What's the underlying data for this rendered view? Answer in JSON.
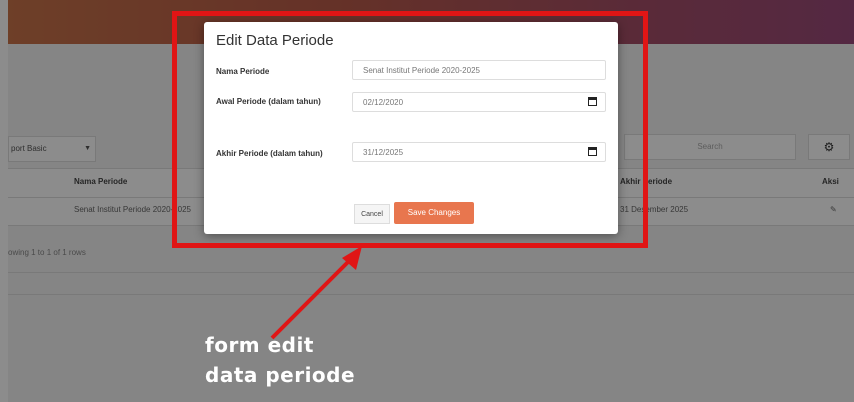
{
  "background": {
    "export_label": "port Basic",
    "search_placeholder": "Search",
    "table": {
      "headers": [
        "Nama Periode",
        "Akhir Periode",
        "Aksi"
      ],
      "row": {
        "nama_periode": "Senat Institut Periode 2020-2025",
        "akhir_periode": "31 Desember 2025"
      }
    },
    "showing": "owing 1 to 1 of 1 rows"
  },
  "modal": {
    "title": "Edit Data Periode",
    "fields": [
      {
        "label": "Nama Periode",
        "value": "Senat Institut Periode 2020-2025"
      },
      {
        "label": "Awal Periode (dalam tahun)",
        "value": "02/12/2020"
      },
      {
        "label": "Akhir Periode (dalam tahun)",
        "value": "31/12/2025"
      }
    ],
    "cancel_label": "Cancel",
    "save_label": "Save Changes"
  },
  "annotation": {
    "caption_line1": "form edit",
    "caption_line2": "data periode",
    "color": "#e01515"
  },
  "icons": {
    "gear": "gear-icon",
    "calendar": "calendar-icon",
    "edit": "edit-icon"
  }
}
